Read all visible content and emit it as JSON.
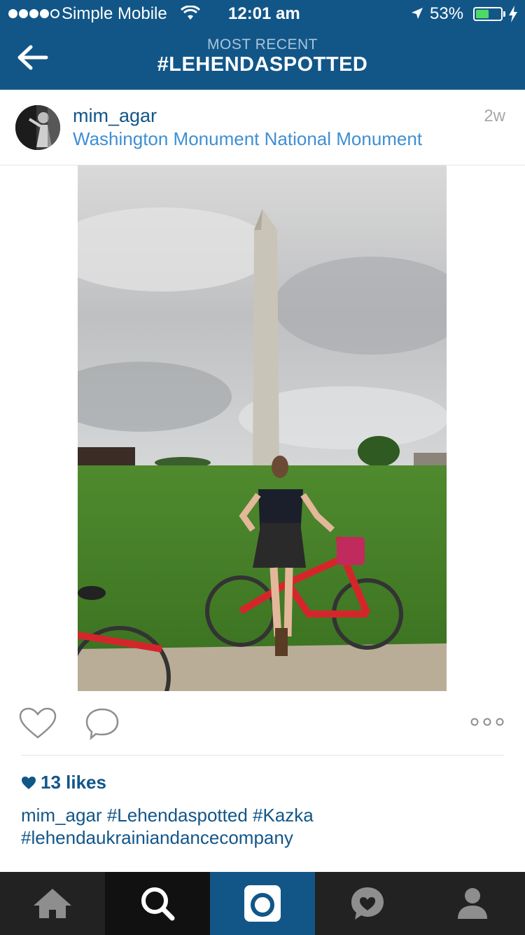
{
  "status_bar": {
    "carrier": "Simple Mobile",
    "time": "12:01 am",
    "battery_percent": "53%",
    "battery_level": 0.53
  },
  "nav": {
    "subtitle": "MOST RECENT",
    "title": "#LEHENDASPOTTED"
  },
  "post": {
    "username": "mim_agar",
    "location": "Washington Monument National Monument",
    "time_ago": "2w",
    "likes": "13 likes",
    "caption_user": "mim_agar",
    "caption_tags": [
      "#Lehendaspotted",
      "#Kazka",
      "#lehendaukrainiandancecompany"
    ]
  },
  "colors": {
    "brand_blue": "#125688",
    "link_blue": "#3f8fd2",
    "tab_bar": "#222222"
  },
  "tabs": [
    {
      "name": "home",
      "icon": "home-icon"
    },
    {
      "name": "search",
      "icon": "search-icon"
    },
    {
      "name": "camera",
      "icon": "camera-icon"
    },
    {
      "name": "activity",
      "icon": "activity-icon"
    },
    {
      "name": "profile",
      "icon": "profile-icon"
    }
  ]
}
